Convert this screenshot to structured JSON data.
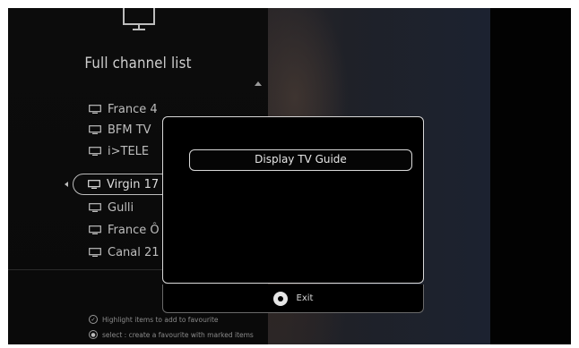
{
  "panel": {
    "title": "Full channel list",
    "channels": [
      {
        "label": "France 4"
      },
      {
        "label": "BFM TV"
      },
      {
        "label": "i>TELE"
      },
      {
        "label": "Virgin 17",
        "selected": true
      },
      {
        "label": "Gulli"
      },
      {
        "label": "France Ô"
      },
      {
        "label": "Canal 21"
      }
    ],
    "hints": [
      {
        "icon": "check-circle-icon",
        "text": "Highlight items to add to favourite"
      },
      {
        "icon": "ok-circle-icon",
        "text": "select : create a favourite with marked items"
      }
    ]
  },
  "dialog": {
    "option_label": "Display TV Guide",
    "exit_label": "Exit"
  },
  "icons": {
    "tv": "tv-icon",
    "exit": "ok-button-icon"
  },
  "colors": {
    "background": "#050505",
    "text": "#cfcfcf",
    "border": "#d8d8d8"
  }
}
